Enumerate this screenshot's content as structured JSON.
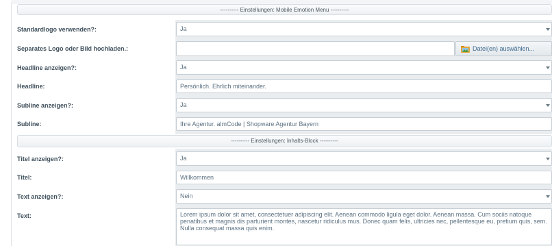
{
  "sections": {
    "mobile_header": "---------- Einstellungen: Mobile Emotion Menu ----------",
    "content_header": "---------- Einstellungen: Inhalts-Block ----------"
  },
  "fields": {
    "standardlogo": {
      "label": "Standardlogo verwenden?:",
      "value": "Ja"
    },
    "separates_logo": {
      "label": "Separates Logo oder Bild hochladen.:",
      "value": "",
      "button_label": "Datei(en) auswählen..."
    },
    "headline_show": {
      "label": "Headline anzeigen?:",
      "value": "Ja"
    },
    "headline": {
      "label": "Headline:",
      "value": "Persönlich. Ehrlich miteinander."
    },
    "subline_show": {
      "label": "Subline anzeigen?:",
      "value": "Ja"
    },
    "subline": {
      "label": "Subline:",
      "value": "Ihre Agentur. almCode | Shopware Agentur Bayern"
    },
    "titel_show": {
      "label": "Titel anzeigen?:",
      "value": "Ja"
    },
    "titel": {
      "label": "Titel:",
      "value": "Willkommen"
    },
    "text_show": {
      "label": "Text anzeigen?:",
      "value": "Nein"
    },
    "text": {
      "label": "Text:",
      "value": "Lorem ipsum dolor sit amet, consectetuer adipiscing elit. Aenean commodo ligula eget dolor. Aenean massa. Cum sociis natoque penatibus et magnis dis parturient montes, nascetur ridiculus mus. Donec quam felis, ultricies nec, pellentesque eu, pretium quis, sem. Nulla consequat massa quis enim."
    }
  },
  "icons": {
    "upload": "folder-image-icon",
    "dropdown": "chevron-down-icon"
  }
}
